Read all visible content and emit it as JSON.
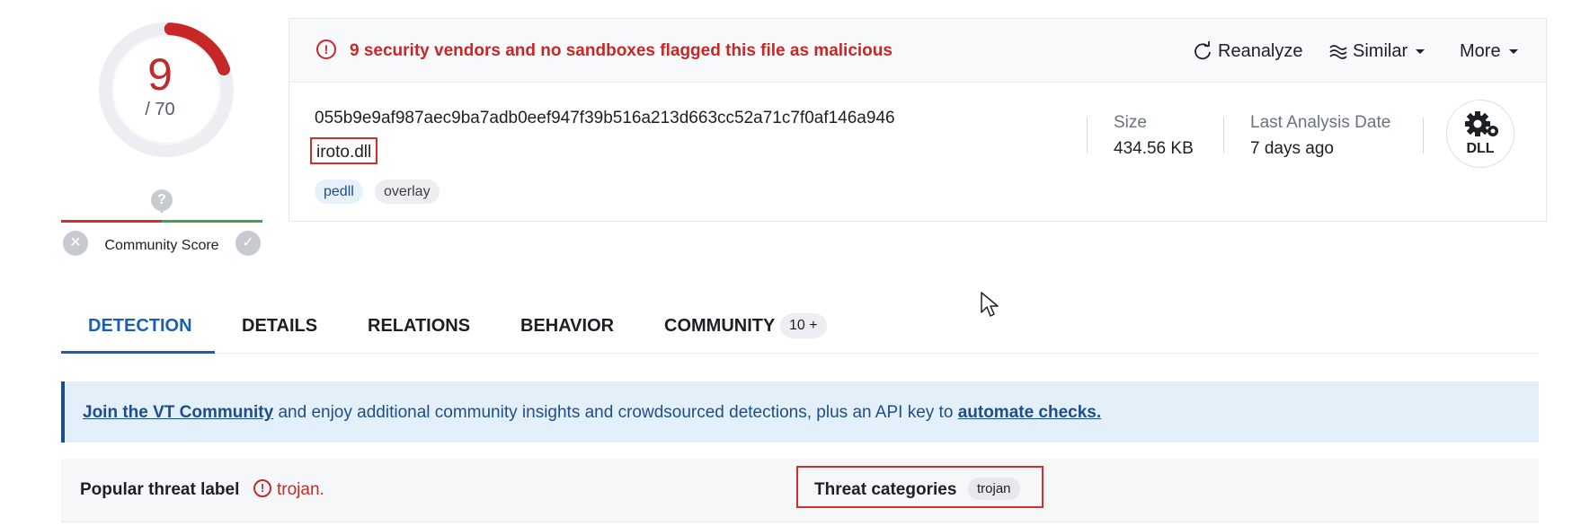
{
  "score": {
    "detections": "9",
    "total": "/ 70",
    "ratio": 0.1286,
    "accent_color": "#c62828"
  },
  "community": {
    "label": "Community Score",
    "unknown_icon": "question-mark-icon",
    "vote_down_icon": "x-circle-icon",
    "vote_up_icon": "check-circle-icon"
  },
  "alert": {
    "icon": "exclamation-circle-icon",
    "text": "9 security vendors and no sandboxes flagged this file as malicious"
  },
  "actions": {
    "reanalyze": "Reanalyze",
    "similar": "Similar",
    "more": "More"
  },
  "file": {
    "hash": "055b9e9af987aec9ba7adb0eef947f39b516a213d663cc52a71c7f0af146a946",
    "name": "iroto.dll",
    "tags": [
      "pedll",
      "overlay"
    ],
    "type_icon_label": "DLL"
  },
  "meta": {
    "size_label": "Size",
    "size_value": "434.56 KB",
    "date_label": "Last Analysis Date",
    "date_value": "7 days ago"
  },
  "tabs": [
    {
      "label": "DETECTION",
      "active": true
    },
    {
      "label": "DETAILS",
      "active": false
    },
    {
      "label": "RELATIONS",
      "active": false
    },
    {
      "label": "BEHAVIOR",
      "active": false
    },
    {
      "label": "COMMUNITY",
      "active": false,
      "badge": "10 +"
    }
  ],
  "banner": {
    "link1": "Join the VT Community",
    "middle": " and enjoy additional community insights and crowdsourced detections, plus an API key to ",
    "link2": "automate checks."
  },
  "threat": {
    "popular_label": "Popular threat label",
    "popular_value": "trojan.",
    "categories_label": "Threat categories",
    "categories_value": "trojan"
  },
  "colors": {
    "malicious": "#c62828",
    "tab_active": "#1a5fb4",
    "banner_bg": "#e3f0fa",
    "banner_text": "#1d4e89"
  }
}
